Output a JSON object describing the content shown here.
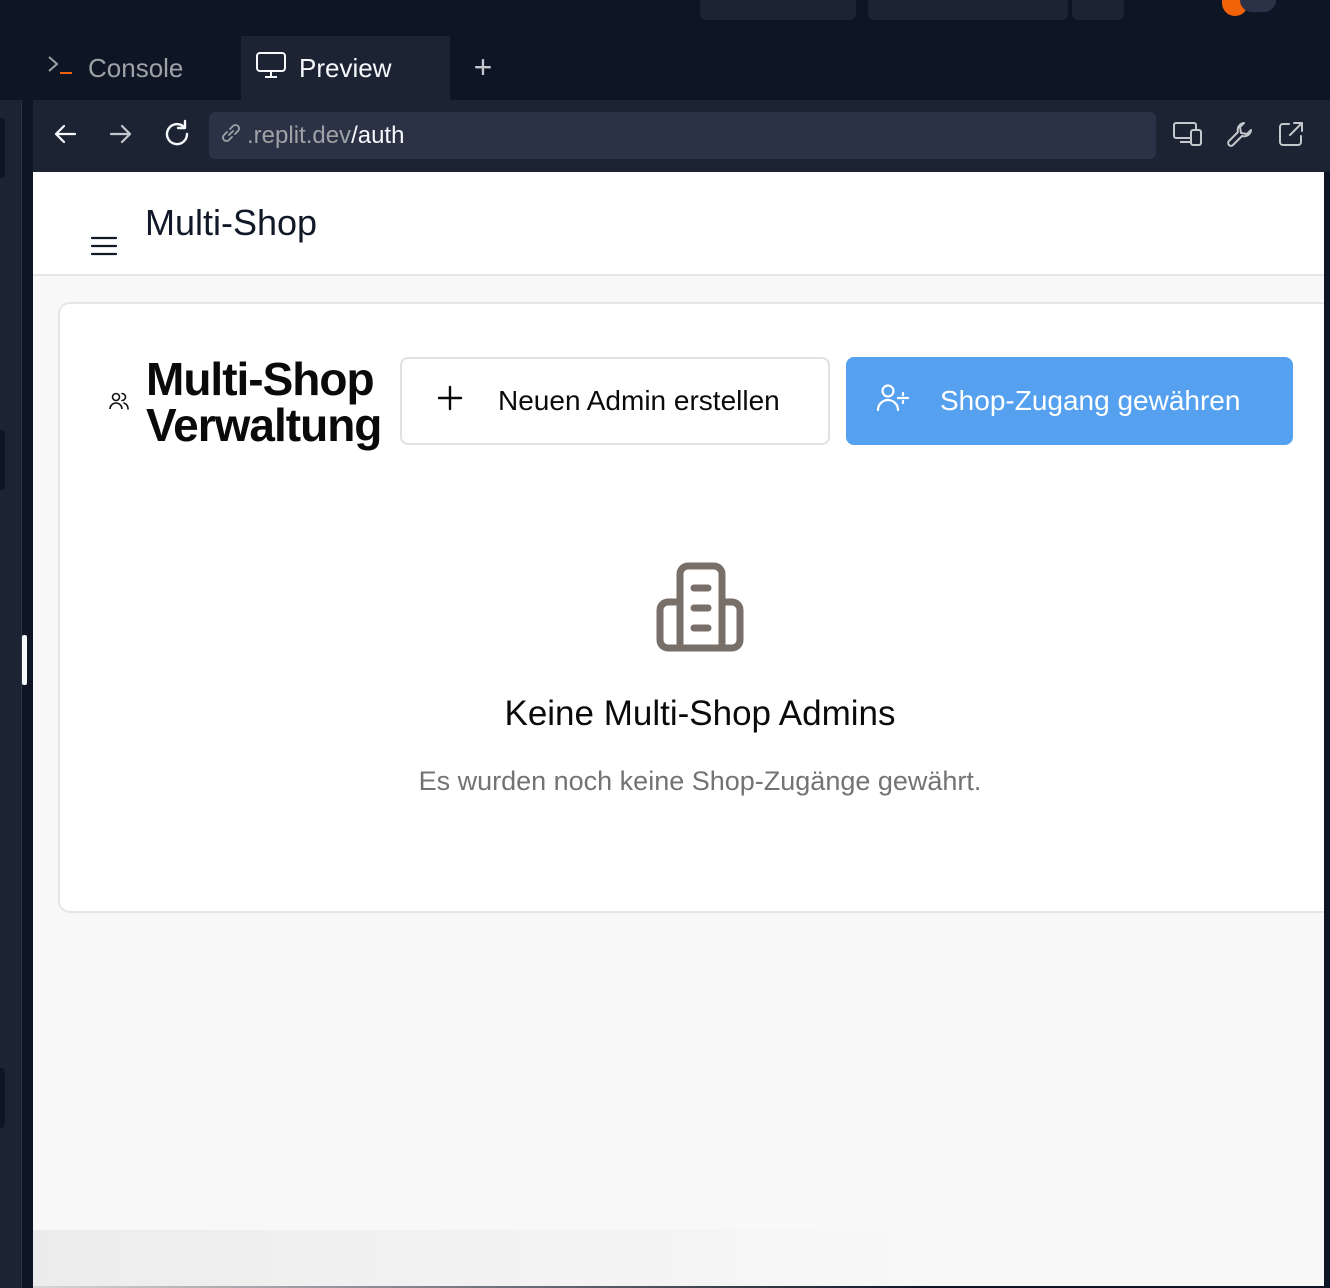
{
  "tabs": {
    "console_label": "Console",
    "preview_label": "Preview",
    "add_label": "+"
  },
  "browser": {
    "url_host": ".replit.dev",
    "url_path": "/auth"
  },
  "app": {
    "title": "Multi-Shop"
  },
  "card": {
    "title_line1": "Multi-Shop",
    "title_line2": "Verwaltung",
    "create_admin_label": "Neuen Admin erstellen",
    "grant_access_label": "Shop-Zugang gewähren"
  },
  "empty_state": {
    "title": "Keine Multi-Shop Admins",
    "subtitle": "Es wurden noch keine Shop-Zugänge gewährt."
  },
  "colors": {
    "primary": "#55a1f0",
    "ide_background": "#0e1525",
    "ide_surface": "#1c2333",
    "empty_icon": "#786f69"
  },
  "icons": {
    "console": "terminal-prompt-icon",
    "preview": "monitor-icon",
    "back": "arrow-left-icon",
    "forward": "arrow-right-icon",
    "reload": "reload-icon",
    "link": "link-icon",
    "devices": "devices-icon",
    "devtools": "wrench-icon",
    "external": "external-link-icon",
    "menu": "hamburger-menu-icon",
    "users": "users-icon",
    "plus": "plus-icon",
    "user_plus": "user-plus-icon",
    "building": "building-icon"
  }
}
